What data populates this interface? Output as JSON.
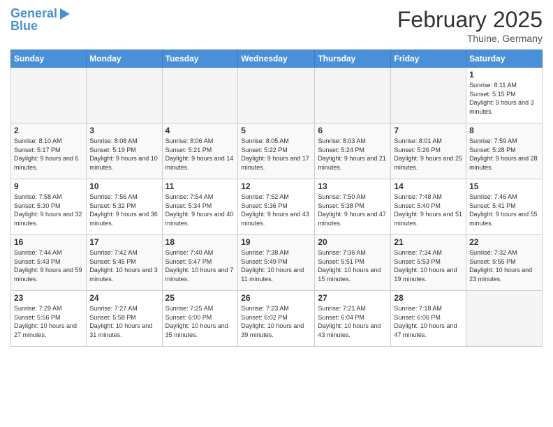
{
  "header": {
    "logo_line1": "General",
    "logo_line2": "Blue",
    "month_title": "February 2025",
    "location": "Thuine, Germany"
  },
  "weekdays": [
    "Sunday",
    "Monday",
    "Tuesday",
    "Wednesday",
    "Thursday",
    "Friday",
    "Saturday"
  ],
  "weeks": [
    [
      {
        "day": "",
        "empty": true
      },
      {
        "day": "",
        "empty": true
      },
      {
        "day": "",
        "empty": true
      },
      {
        "day": "",
        "empty": true
      },
      {
        "day": "",
        "empty": true
      },
      {
        "day": "",
        "empty": true
      },
      {
        "day": "1",
        "sunrise": "Sunrise: 8:11 AM",
        "sunset": "Sunset: 5:15 PM",
        "daylight": "Daylight: 9 hours and 3 minutes."
      }
    ],
    [
      {
        "day": "2",
        "sunrise": "Sunrise: 8:10 AM",
        "sunset": "Sunset: 5:17 PM",
        "daylight": "Daylight: 9 hours and 6 minutes."
      },
      {
        "day": "3",
        "sunrise": "Sunrise: 8:08 AM",
        "sunset": "Sunset: 5:19 PM",
        "daylight": "Daylight: 9 hours and 10 minutes."
      },
      {
        "day": "4",
        "sunrise": "Sunrise: 8:06 AM",
        "sunset": "Sunset: 5:21 PM",
        "daylight": "Daylight: 9 hours and 14 minutes."
      },
      {
        "day": "5",
        "sunrise": "Sunrise: 8:05 AM",
        "sunset": "Sunset: 5:22 PM",
        "daylight": "Daylight: 9 hours and 17 minutes."
      },
      {
        "day": "6",
        "sunrise": "Sunrise: 8:03 AM",
        "sunset": "Sunset: 5:24 PM",
        "daylight": "Daylight: 9 hours and 21 minutes."
      },
      {
        "day": "7",
        "sunrise": "Sunrise: 8:01 AM",
        "sunset": "Sunset: 5:26 PM",
        "daylight": "Daylight: 9 hours and 25 minutes."
      },
      {
        "day": "8",
        "sunrise": "Sunrise: 7:59 AM",
        "sunset": "Sunset: 5:28 PM",
        "daylight": "Daylight: 9 hours and 28 minutes."
      }
    ],
    [
      {
        "day": "9",
        "sunrise": "Sunrise: 7:58 AM",
        "sunset": "Sunset: 5:30 PM",
        "daylight": "Daylight: 9 hours and 32 minutes."
      },
      {
        "day": "10",
        "sunrise": "Sunrise: 7:56 AM",
        "sunset": "Sunset: 5:32 PM",
        "daylight": "Daylight: 9 hours and 36 minutes."
      },
      {
        "day": "11",
        "sunrise": "Sunrise: 7:54 AM",
        "sunset": "Sunset: 5:34 PM",
        "daylight": "Daylight: 9 hours and 40 minutes."
      },
      {
        "day": "12",
        "sunrise": "Sunrise: 7:52 AM",
        "sunset": "Sunset: 5:36 PM",
        "daylight": "Daylight: 9 hours and 43 minutes."
      },
      {
        "day": "13",
        "sunrise": "Sunrise: 7:50 AM",
        "sunset": "Sunset: 5:38 PM",
        "daylight": "Daylight: 9 hours and 47 minutes."
      },
      {
        "day": "14",
        "sunrise": "Sunrise: 7:48 AM",
        "sunset": "Sunset: 5:40 PM",
        "daylight": "Daylight: 9 hours and 51 minutes."
      },
      {
        "day": "15",
        "sunrise": "Sunrise: 7:46 AM",
        "sunset": "Sunset: 5:41 PM",
        "daylight": "Daylight: 9 hours and 55 minutes."
      }
    ],
    [
      {
        "day": "16",
        "sunrise": "Sunrise: 7:44 AM",
        "sunset": "Sunset: 5:43 PM",
        "daylight": "Daylight: 9 hours and 59 minutes."
      },
      {
        "day": "17",
        "sunrise": "Sunrise: 7:42 AM",
        "sunset": "Sunset: 5:45 PM",
        "daylight": "Daylight: 10 hours and 3 minutes."
      },
      {
        "day": "18",
        "sunrise": "Sunrise: 7:40 AM",
        "sunset": "Sunset: 5:47 PM",
        "daylight": "Daylight: 10 hours and 7 minutes."
      },
      {
        "day": "19",
        "sunrise": "Sunrise: 7:38 AM",
        "sunset": "Sunset: 5:49 PM",
        "daylight": "Daylight: 10 hours and 11 minutes."
      },
      {
        "day": "20",
        "sunrise": "Sunrise: 7:36 AM",
        "sunset": "Sunset: 5:51 PM",
        "daylight": "Daylight: 10 hours and 15 minutes."
      },
      {
        "day": "21",
        "sunrise": "Sunrise: 7:34 AM",
        "sunset": "Sunset: 5:53 PM",
        "daylight": "Daylight: 10 hours and 19 minutes."
      },
      {
        "day": "22",
        "sunrise": "Sunrise: 7:32 AM",
        "sunset": "Sunset: 5:55 PM",
        "daylight": "Daylight: 10 hours and 23 minutes."
      }
    ],
    [
      {
        "day": "23",
        "sunrise": "Sunrise: 7:29 AM",
        "sunset": "Sunset: 5:56 PM",
        "daylight": "Daylight: 10 hours and 27 minutes."
      },
      {
        "day": "24",
        "sunrise": "Sunrise: 7:27 AM",
        "sunset": "Sunset: 5:58 PM",
        "daylight": "Daylight: 10 hours and 31 minutes."
      },
      {
        "day": "25",
        "sunrise": "Sunrise: 7:25 AM",
        "sunset": "Sunset: 6:00 PM",
        "daylight": "Daylight: 10 hours and 35 minutes."
      },
      {
        "day": "26",
        "sunrise": "Sunrise: 7:23 AM",
        "sunset": "Sunset: 6:02 PM",
        "daylight": "Daylight: 10 hours and 39 minutes."
      },
      {
        "day": "27",
        "sunrise": "Sunrise: 7:21 AM",
        "sunset": "Sunset: 6:04 PM",
        "daylight": "Daylight: 10 hours and 43 minutes."
      },
      {
        "day": "28",
        "sunrise": "Sunrise: 7:18 AM",
        "sunset": "Sunset: 6:06 PM",
        "daylight": "Daylight: 10 hours and 47 minutes."
      },
      {
        "day": "",
        "empty": true
      }
    ]
  ]
}
